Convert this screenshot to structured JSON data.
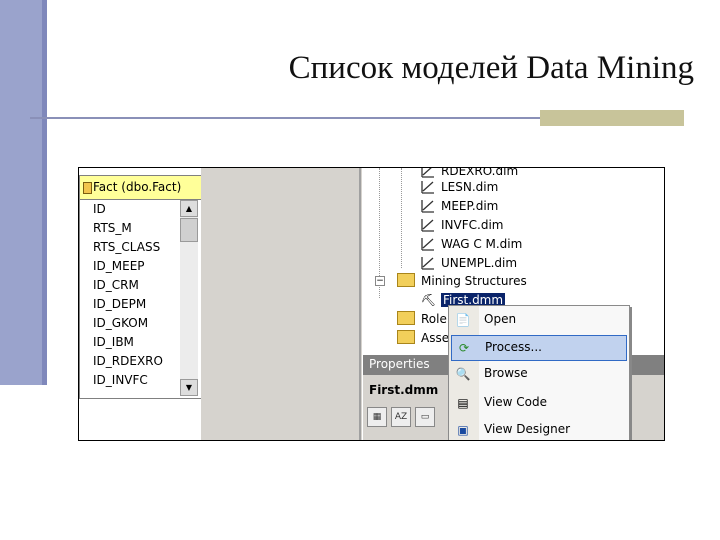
{
  "slide": {
    "title": "Список моделей Data Mining"
  },
  "table": {
    "header": "Fact (dbo.Fact)",
    "columns": [
      "ID",
      "RTS_M",
      "RTS_CLASS",
      "ID_MEEP",
      "ID_CRM",
      "ID_DEPM",
      "ID_GKOM",
      "ID_IBM",
      "ID_RDEXRO",
      "ID_INVFC"
    ]
  },
  "tree": {
    "dims": [
      "RDEXRO.dim",
      "LESN.dim",
      "MEEP.dim",
      "INVFC.dim",
      "WAG C M.dim",
      "UNEMPL.dim"
    ],
    "mining_structures": "Mining Structures",
    "selected_item": "First.dmm",
    "roles_partial": "Role",
    "assemblies_partial": "Asse"
  },
  "properties": {
    "title": "Properties",
    "object": "First.dmm"
  },
  "context_menu": {
    "items": [
      {
        "label": "Open",
        "icon": "open-icon"
      },
      {
        "label": "Process...",
        "icon": "process-icon",
        "highlighted": true
      },
      {
        "label": "Browse",
        "icon": "browse-icon"
      },
      {
        "label": "View Code",
        "icon": "view-code-icon"
      },
      {
        "label": "View Designer",
        "icon": "view-designer-icon"
      }
    ]
  },
  "colors": {
    "sidebar": "#9aa3cc",
    "table_header": "#ffff99",
    "selection": "#0a246a",
    "menu_highlight": "#c1d2ee"
  }
}
